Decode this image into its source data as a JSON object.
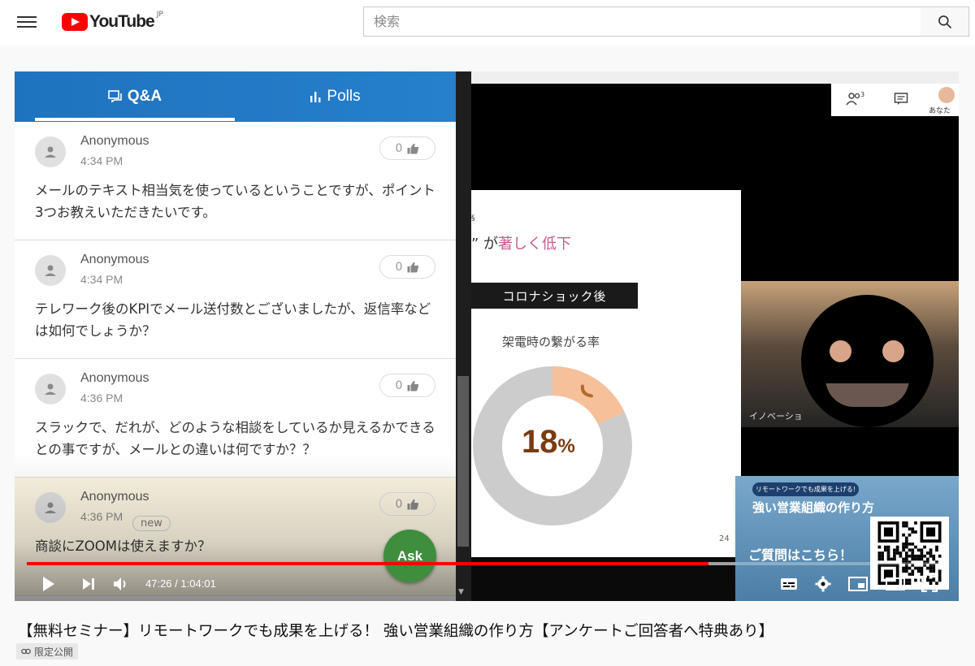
{
  "header": {
    "logo_text": "YouTube",
    "logo_region": "JP",
    "search_placeholder": "検索"
  },
  "qa_panel": {
    "tabs": [
      {
        "label": "Q&A",
        "active": true
      },
      {
        "label": "Polls",
        "active": false
      }
    ],
    "items": [
      {
        "name": "Anonymous",
        "time": "4:34 PM",
        "badge": "",
        "likes": "0",
        "text": "メールのテキスト相当気を使っているということですが、ポイント3つお教えいただきたいです。"
      },
      {
        "name": "Anonymous",
        "time": "4:34 PM",
        "badge": "",
        "likes": "0",
        "text": "テレワーク後のKPIでメール送付数とございましたが、返信率などは如何でしょうか？"
      },
      {
        "name": "Anonymous",
        "time": "4:36 PM",
        "badge": "",
        "likes": "0",
        "text": "スラックで、だれが、どのような相談をしているか見えるかできるとの事ですが、メールとの違いは何ですか？？"
      },
      {
        "name": "Anonymous",
        "time": "4:36 PM",
        "badge": "new",
        "likes": "0",
        "text": "商談にZOOMは使えますか？"
      }
    ],
    "ask_label": "Ask"
  },
  "video": {
    "participants_count": "3",
    "you_label": "あなた",
    "slide": {
      "mark": "§",
      "title_prefix": "” が",
      "title_highlight": "著しく低下",
      "tag": "コロナショック後",
      "subtitle": "架電時の繋がる率",
      "percent_value": "18",
      "percent_unit": "%",
      "page_number": "24",
      "donut_fraction": 0.18
    },
    "camera_name": "イノベーショ",
    "promo": {
      "pill": "リモートワークでも成果を上げる!",
      "title": "強い営業組織の作り方",
      "question": "ご質問はこちら！"
    }
  },
  "controls": {
    "current_time": "47:26",
    "separator": "/",
    "duration": "1:04:01",
    "played_fraction": 0.741,
    "buffered_fraction": 0.77
  },
  "below_player": {
    "title": "【無料セミナー】リモートワークでも成果を上げる！ 強い営業組織の作り方【アンケートご回答者へ特典あり】",
    "privacy_label": "限定公開"
  },
  "colors": {
    "brand_red": "#ff0000",
    "qa_header_blue": "#1e73be",
    "ask_green": "#3e8e3e",
    "slide_highlight": "#c85a8e",
    "percent_brown": "#7a3b10",
    "donut_orange": "#f6c09b",
    "donut_gray": "#cccccc"
  }
}
